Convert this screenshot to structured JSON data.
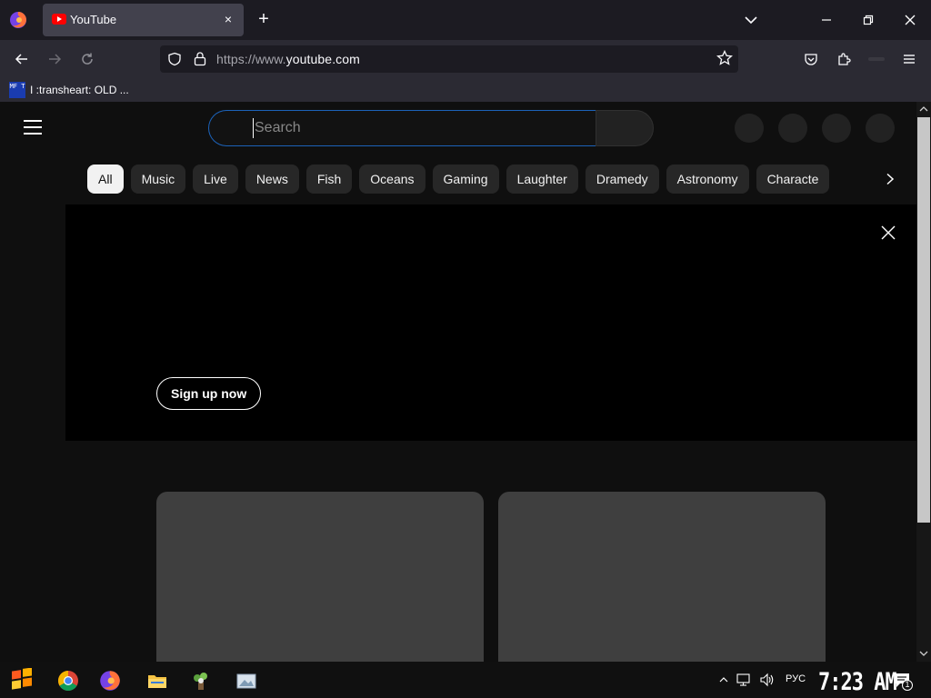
{
  "browser": {
    "tab_title": "YouTube",
    "tab_close": "×",
    "new_tab": "+",
    "url_prefix": "https://www.",
    "url_domain": "youtube.com",
    "bookmark_icon_text": "MF T",
    "bookmark_label": "I :transheart: OLD ..."
  },
  "youtube": {
    "search_placeholder": "Search",
    "chips": [
      "All",
      "Music",
      "Live",
      "News",
      "Fish",
      "Oceans",
      "Gaming",
      "Laughter",
      "Dramedy",
      "Astronomy",
      "Characte"
    ],
    "active_chip": "All",
    "banner_button": "Sign up now"
  },
  "taskbar": {
    "language": "РУС",
    "clock": "7:23 AM",
    "notification_count": "1"
  },
  "colors": {
    "browser_dark": "#1c1b22",
    "browser_toolbar": "#2b2a33",
    "yt_background": "#0f0f0f",
    "search_focus": "#1c62b9",
    "chip_bg": "#272727"
  }
}
